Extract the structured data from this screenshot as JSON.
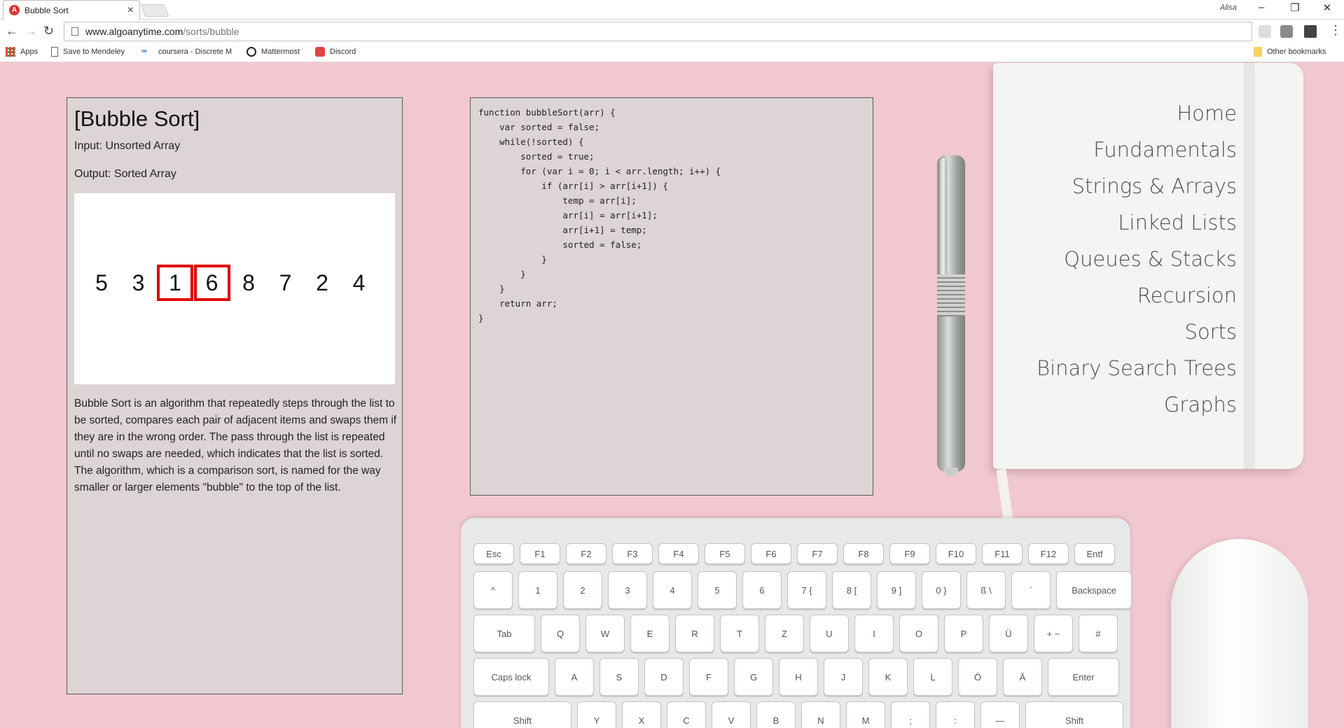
{
  "browser": {
    "tab_title": "Bubble Sort",
    "tab_icon": "A",
    "profile_name": "Alisa",
    "url_host": "www.algoanytime.com",
    "url_path": "/sorts/bubble",
    "bookmarks": [
      {
        "label": "Apps",
        "icon": "apps-grid-icon"
      },
      {
        "label": "Save to Mendeley",
        "icon": "page-icon"
      },
      {
        "label": "coursera - Discrete M",
        "icon": "coursera-icon"
      },
      {
        "label": "Mattermost",
        "icon": "mattermost-icon"
      },
      {
        "label": "Discord",
        "icon": "discord-icon"
      }
    ],
    "other_bookmarks": "Other bookmarks"
  },
  "info": {
    "title": "[Bubble Sort]",
    "input": "Input: Unsorted Array",
    "output": "Output: Sorted Array",
    "array": [
      "5",
      "3",
      "1",
      "6",
      "8",
      "7",
      "2",
      "4"
    ],
    "highlighted": [
      2,
      3
    ],
    "highlight_color": "#e00000",
    "description": "Bubble Sort is an algorithm that repeatedly steps through the list to be sorted, compares each pair of adjacent items and swaps them if they are in the wrong order. The pass through the list is repeated until no swaps are needed, which indicates that the list is sorted. The algorithm, which is a comparison sort, is named for the way smaller or larger elements \"bubble\" to the top of the list."
  },
  "code": "function bubbleSort(arr) {\n    var sorted = false;\n    while(!sorted) {\n        sorted = true;\n        for (var i = 0; i < arr.length; i++) {\n            if (arr[i] > arr[i+1]) {\n                temp = arr[i];\n                arr[i] = arr[i+1];\n                arr[i+1] = temp;\n                sorted = false;\n            }\n        }\n    }\n    return arr;\n}",
  "nav": [
    "Home",
    "Fundamentals",
    "Strings & Arrays",
    "Linked Lists",
    "Queues & Stacks",
    "Recursion",
    "Sorts",
    "Binary Search Trees",
    "Graphs"
  ],
  "keyboard": {
    "row1": [
      "Esc",
      "F1",
      "F2",
      "F3",
      "F4",
      "F5",
      "F6",
      "F7",
      "F8",
      "F9",
      "F10",
      "F11",
      "F12",
      "Entf"
    ],
    "row2": [
      "^",
      "1",
      "2",
      "3",
      "4",
      "5",
      "6",
      "7 {",
      "8 [",
      "9 ]",
      "0 }",
      "ß \\",
      "´",
      "Backspace"
    ],
    "row3": [
      "Tab",
      "Q",
      "W",
      "E",
      "R",
      "T",
      "Z",
      "U",
      "I",
      "O",
      "P",
      "Ü",
      "+ ~",
      "#"
    ],
    "row4": [
      "Caps lock",
      "A",
      "S",
      "D",
      "F",
      "G",
      "H",
      "J",
      "K",
      "L",
      "Ö",
      "Ä",
      "Enter"
    ],
    "row5": [
      "Shift",
      "Y",
      "X",
      "C",
      "V",
      "B",
      "N",
      "M",
      ";",
      ":",
      "—",
      "Shift"
    ]
  }
}
